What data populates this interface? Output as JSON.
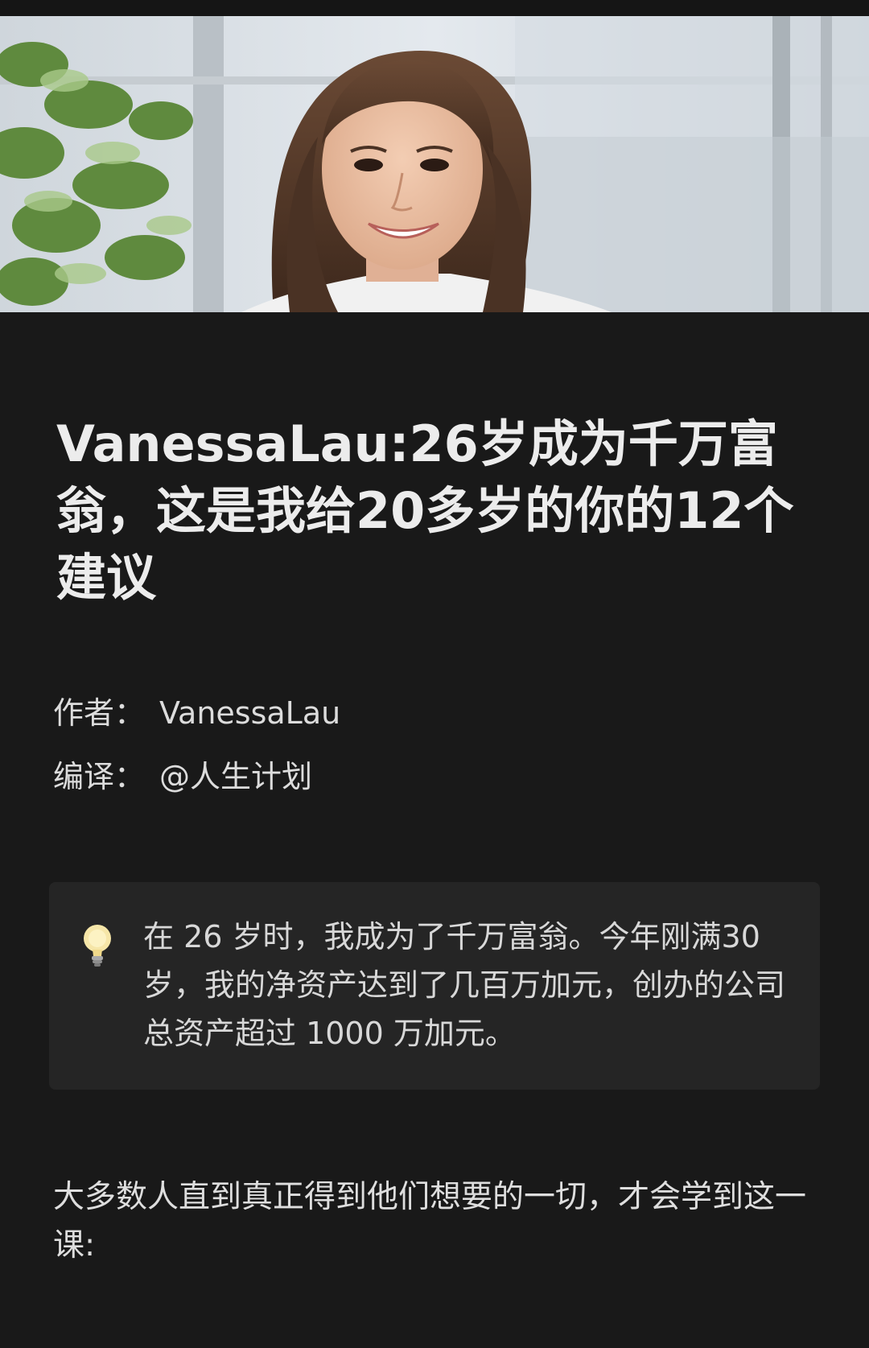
{
  "article": {
    "title": "VanessaLau:26岁成为千万富翁，这是我给20多岁的你的12个建议",
    "author_label": "作者：",
    "author_value": "VanessaLau",
    "translator_label": "编译：",
    "translator_value": "@人生计划",
    "callout_icon": "lightbulb-icon",
    "callout_text": "在 26 岁时，我成为了千万富翁。今年刚满30岁，我的净资产达到了几百万加元，创办的公司总资产超过 1000 万加元。",
    "body_paragraph": "大多数人直到真正得到他们想要的一切，才会学到这一课:"
  },
  "colors": {
    "background": "#191919",
    "callout_background": "#252525",
    "text": "#ececec"
  }
}
